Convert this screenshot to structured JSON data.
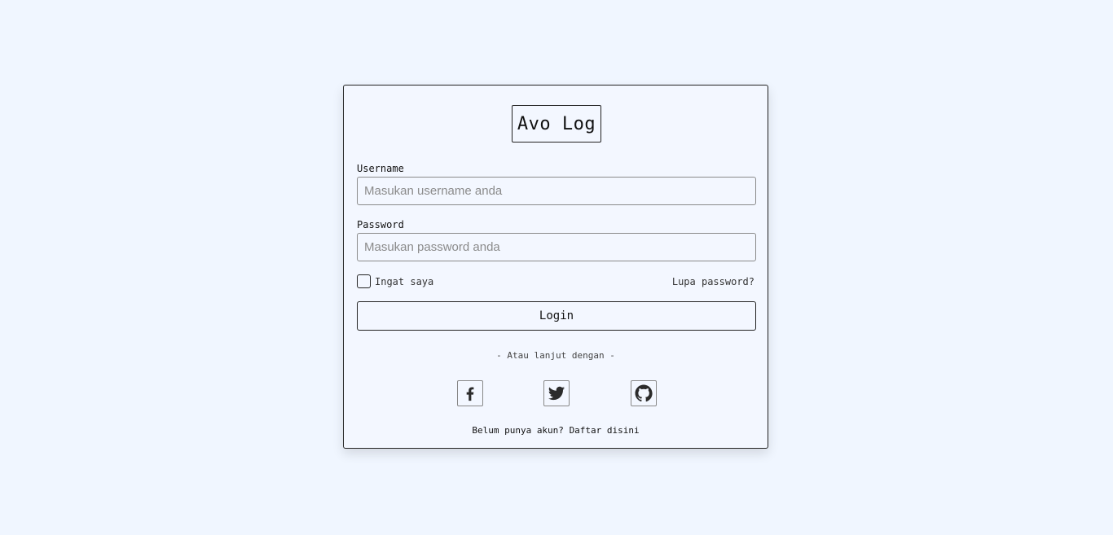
{
  "app": {
    "logo_text": "Avo Log"
  },
  "form": {
    "username_label": "Username",
    "username_placeholder": "Masukan username anda",
    "username_value": "",
    "password_label": "Password",
    "password_placeholder": "Masukan password anda",
    "password_value": "",
    "remember_label": "Ingat saya",
    "remember_checked": false,
    "forgot_link": "Lupa password?",
    "login_button": "Login"
  },
  "social": {
    "divider_text": "- Atau lanjut dengan -",
    "providers": [
      {
        "name": "facebook",
        "icon": "facebook-icon"
      },
      {
        "name": "twitter",
        "icon": "twitter-icon"
      },
      {
        "name": "github",
        "icon": "github-icon"
      }
    ]
  },
  "footer": {
    "signup_prompt": "Belum punya akun?",
    "signup_link": "Daftar disini"
  },
  "colors": {
    "background": "#f0f6ff",
    "card": "#f3f7ff",
    "border": "#222222",
    "icon": "#2b2b2b"
  }
}
